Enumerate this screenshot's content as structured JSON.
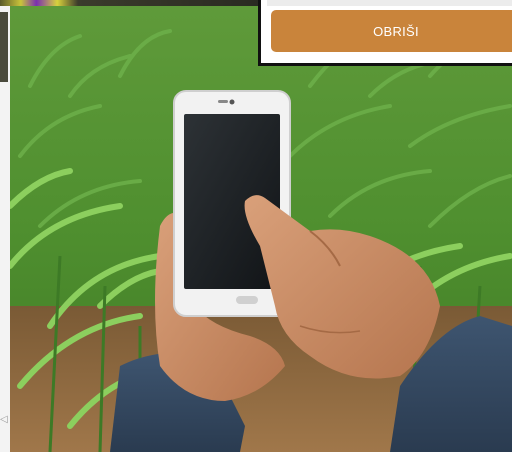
{
  "popup": {
    "delete_label": "OBRIŠI"
  },
  "photo": {
    "subject": "hands-with-smartphone-in-corn-field"
  },
  "colors": {
    "delete_button": "#c9843b",
    "popup_border": "#111111"
  }
}
